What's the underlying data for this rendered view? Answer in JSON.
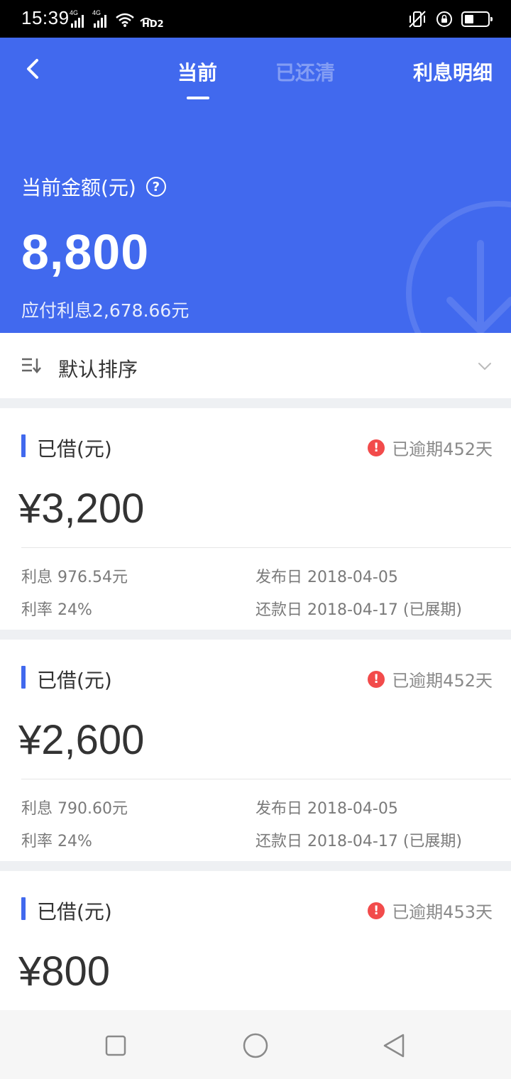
{
  "status_bar": {
    "time": "15:39",
    "network_tags": [
      "4G",
      "4G"
    ],
    "extra_tag": "HD2"
  },
  "header": {
    "tabs": [
      {
        "label": "当前",
        "active": true
      },
      {
        "label": "已还清",
        "active": false
      }
    ],
    "interest_detail_label": "利息明细",
    "amount_label": "当前金额(元)",
    "amount_value": "8,800",
    "interest_due": "应付利息2,678.66元",
    "accent_color": "#4169ee"
  },
  "sort": {
    "label": "默认排序"
  },
  "loans": [
    {
      "title": "已借(元)",
      "overdue_text": "已逾期452天",
      "amount": "¥3,200",
      "interest": "利息 976.54元",
      "rate": "利率 24%",
      "publish_date": "发布日 2018-04-05",
      "repay_date": "还款日 2018-04-17 (已展期)"
    },
    {
      "title": "已借(元)",
      "overdue_text": "已逾期452天",
      "amount": "¥2,600",
      "interest": "利息 790.60元",
      "rate": "利率 24%",
      "publish_date": "发布日 2018-04-05",
      "repay_date": "还款日 2018-04-17 (已展期)"
    },
    {
      "title": "已借(元)",
      "overdue_text": "已逾期453天",
      "amount": "¥800"
    }
  ],
  "colors": {
    "overdue_red": "#f24b4b",
    "header_blue": "#4169ee"
  }
}
